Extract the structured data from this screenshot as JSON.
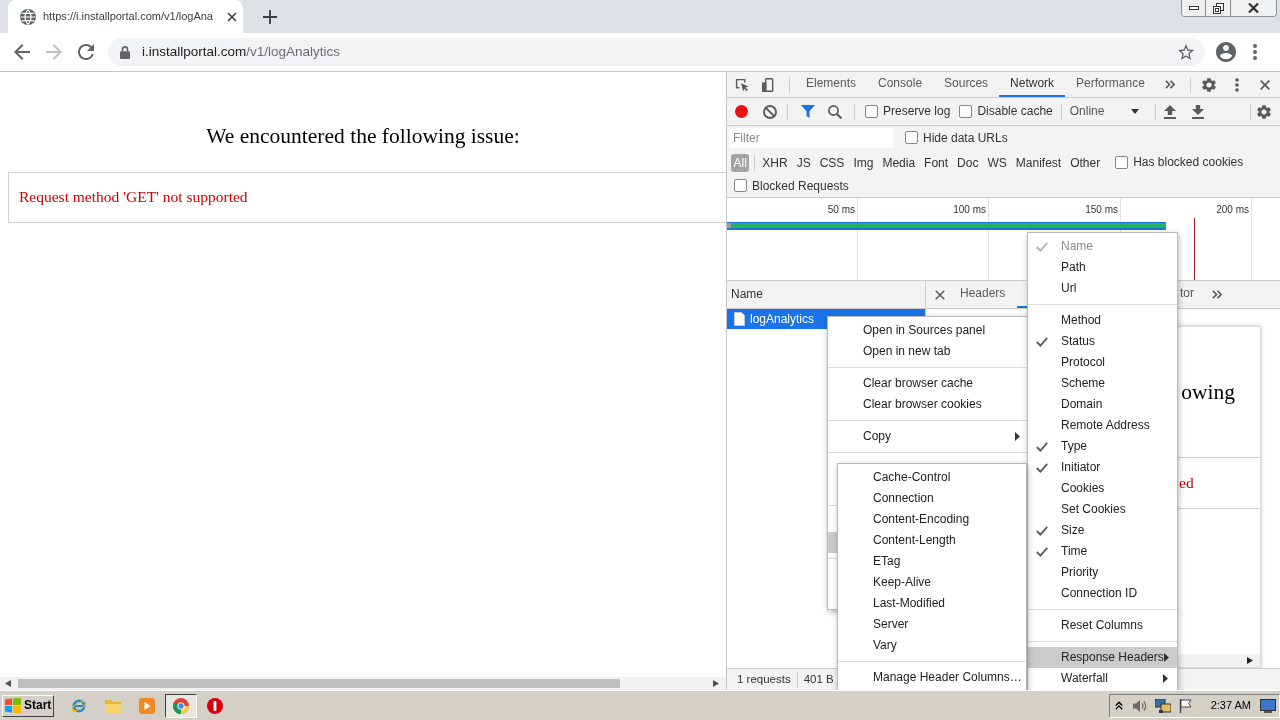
{
  "browser_tab": {
    "title": "https://i.installportal.com/v1/logAna"
  },
  "nav_buttons": [
    {
      "kind": "back",
      "disabled": false
    },
    {
      "kind": "forward",
      "disabled": true
    },
    {
      "kind": "reload",
      "disabled": false
    }
  ],
  "address_bar": {
    "host": "i.installportal.com",
    "path": "/v1/logAnalytics"
  },
  "page": {
    "heading": "We encountered the following issue:",
    "message": "Request method 'GET' not supported"
  },
  "devtools": {
    "tabs": [
      {
        "label": "Elements",
        "selected": false
      },
      {
        "label": "Console",
        "selected": false
      },
      {
        "label": "Sources",
        "selected": false
      },
      {
        "label": "Network",
        "selected": true
      },
      {
        "label": "Performance",
        "selected": false
      }
    ],
    "toolbar": {
      "recording": true,
      "filter_active": true,
      "options": [
        {
          "label": "Preserve log",
          "checked": false
        },
        {
          "label": "Disable cache",
          "checked": false
        }
      ],
      "throttling": "Online"
    },
    "filter": {
      "placeholder": "Filter",
      "options": [
        {
          "label": "Hide data URLs",
          "checked": false
        }
      ]
    },
    "types": [
      {
        "label": "All",
        "selected": true
      },
      {
        "label": "XHR",
        "selected": false
      },
      {
        "label": "JS",
        "selected": false
      },
      {
        "label": "CSS",
        "selected": false
      },
      {
        "label": "Img",
        "selected": false
      },
      {
        "label": "Media",
        "selected": false
      },
      {
        "label": "Font",
        "selected": false
      },
      {
        "label": "Doc",
        "selected": false
      },
      {
        "label": "WS",
        "selected": false
      },
      {
        "label": "Manifest",
        "selected": false
      },
      {
        "label": "Other",
        "selected": false
      }
    ],
    "type_options": [
      {
        "label": "Has blocked cookies",
        "checked": false
      }
    ],
    "blocked_requests": {
      "label": "Blocked Requests",
      "checked": false
    },
    "overview": {
      "ticks": [
        "50 ms",
        "100 ms",
        "150 ms",
        "200 ms"
      ]
    },
    "requests": {
      "column": "Name",
      "rows": [
        {
          "name": "logAnalytics",
          "selected": true
        }
      ]
    },
    "detail_tabs": [
      {
        "kind": "tab",
        "label": "Headers",
        "selected": false
      },
      {
        "kind": "covered",
        "selected": true
      },
      {
        "kind": "tab",
        "label": "tor",
        "selected": false
      }
    ],
    "preview": {
      "heading": "owing",
      "message": "ed"
    },
    "summary": [
      "1 requests",
      "401 B"
    ]
  },
  "context_menu": {
    "items": [
      {
        "kind": "item",
        "label": "Open in Sources panel"
      },
      {
        "kind": "item",
        "label": "Open in new tab"
      },
      {
        "kind": "separator"
      },
      {
        "kind": "item",
        "label": "Clear browser cache"
      },
      {
        "kind": "item",
        "label": "Clear browser cookies"
      },
      {
        "kind": "separator"
      },
      {
        "kind": "submenu",
        "label": "Copy"
      },
      {
        "kind": "separator"
      },
      {
        "kind": "covered",
        "highlighted": false
      },
      {
        "kind": "covered",
        "highlighted": false
      },
      {
        "kind": "separator"
      },
      {
        "kind": "covered",
        "highlighted": false
      },
      {
        "kind": "covered",
        "highlighted": true
      },
      {
        "kind": "separator"
      },
      {
        "kind": "covered",
        "highlighted": false
      },
      {
        "kind": "covered",
        "highlighted": false
      }
    ]
  },
  "columns_menu": {
    "items": [
      {
        "kind": "check",
        "label": "Name",
        "checked": true,
        "disabled": true
      },
      {
        "kind": "check",
        "label": "Path",
        "checked": false,
        "disabled": false
      },
      {
        "kind": "check",
        "label": "Url",
        "checked": false,
        "disabled": false
      },
      {
        "kind": "separator"
      },
      {
        "kind": "check",
        "label": "Method",
        "checked": false,
        "disabled": false
      },
      {
        "kind": "check",
        "label": "Status",
        "checked": true,
        "disabled": false
      },
      {
        "kind": "check",
        "label": "Protocol",
        "checked": false,
        "disabled": false
      },
      {
        "kind": "check",
        "label": "Scheme",
        "checked": false,
        "disabled": false
      },
      {
        "kind": "check",
        "label": "Domain",
        "checked": false,
        "disabled": false
      },
      {
        "kind": "check",
        "label": "Remote Address",
        "checked": false,
        "disabled": false
      },
      {
        "kind": "check",
        "label": "Type",
        "checked": true,
        "disabled": false
      },
      {
        "kind": "check",
        "label": "Initiator",
        "checked": true,
        "disabled": false
      },
      {
        "kind": "check",
        "label": "Cookies",
        "checked": false,
        "disabled": false
      },
      {
        "kind": "check",
        "label": "Set Cookies",
        "checked": false,
        "disabled": false
      },
      {
        "kind": "check",
        "label": "Size",
        "checked": true,
        "disabled": false
      },
      {
        "kind": "check",
        "label": "Time",
        "checked": true,
        "disabled": false
      },
      {
        "kind": "check",
        "label": "Priority",
        "checked": false,
        "disabled": false
      },
      {
        "kind": "check",
        "label": "Connection ID",
        "checked": false,
        "disabled": false
      },
      {
        "kind": "separator"
      },
      {
        "kind": "item",
        "label": "Reset Columns"
      },
      {
        "kind": "separator"
      },
      {
        "kind": "submenu",
        "label": "Response Headers",
        "highlighted": true
      },
      {
        "kind": "submenu",
        "label": "Waterfall",
        "highlighted": false
      }
    ]
  },
  "headers_menu": {
    "items": [
      {
        "kind": "item",
        "label": "Cache-Control"
      },
      {
        "kind": "item",
        "label": "Connection"
      },
      {
        "kind": "item",
        "label": "Content-Encoding"
      },
      {
        "kind": "item",
        "label": "Content-Length"
      },
      {
        "kind": "item",
        "label": "ETag"
      },
      {
        "kind": "item",
        "label": "Keep-Alive"
      },
      {
        "kind": "item",
        "label": "Last-Modified"
      },
      {
        "kind": "item",
        "label": "Server"
      },
      {
        "kind": "item",
        "label": "Vary"
      },
      {
        "kind": "separator"
      },
      {
        "kind": "item",
        "label": "Manage Header Columns…"
      }
    ]
  },
  "taskbar": {
    "start": "Start",
    "apps": [
      {
        "kind": "ie",
        "active": false
      },
      {
        "kind": "folder",
        "active": false
      },
      {
        "kind": "media",
        "active": false
      },
      {
        "kind": "chrome",
        "active": true
      },
      {
        "kind": "stop",
        "active": false
      }
    ],
    "clock": "2:37 AM"
  }
}
